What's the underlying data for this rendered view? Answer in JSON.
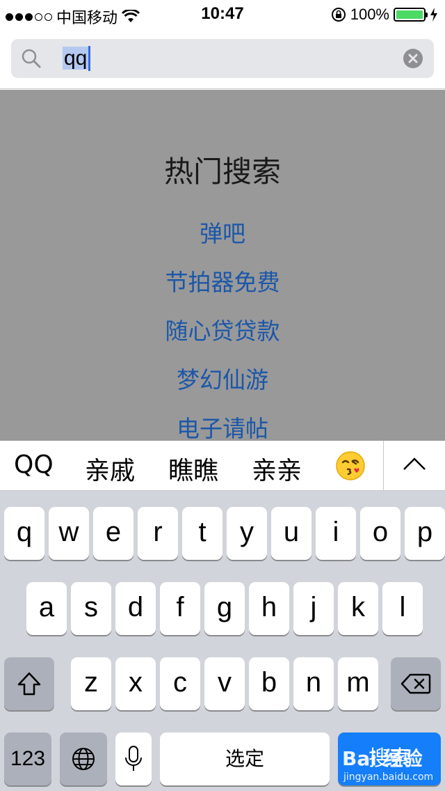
{
  "status_bar": {
    "carrier": "中国移动",
    "time": "10:47",
    "battery": "100%",
    "battery_level": 1.0
  },
  "search": {
    "query": "qq"
  },
  "hot_search": {
    "title": "热门搜索",
    "items": [
      "弹吧",
      "节拍器免费",
      "随心贷贷款",
      "梦幻仙游",
      "电子请帖"
    ]
  },
  "suggestions": {
    "items": [
      "QQ",
      "亲戚",
      "瞧瞧",
      "亲亲"
    ],
    "emoji": "kissing-face-emoji"
  },
  "keyboard": {
    "row1": [
      "q",
      "w",
      "e",
      "r",
      "t",
      "y",
      "u",
      "i",
      "o",
      "p"
    ],
    "row2": [
      "a",
      "s",
      "d",
      "f",
      "g",
      "h",
      "j",
      "k",
      "l"
    ],
    "row3": [
      "z",
      "x",
      "c",
      "v",
      "b",
      "n",
      "m"
    ],
    "numbers_label": "123",
    "space_label": "选定",
    "go_label": "搜索"
  },
  "watermark": {
    "main": "Bai 经验",
    "sub": "jingyan.baidu.com"
  },
  "colors": {
    "accent": "#147efb",
    "link": "#1b57a8",
    "overlay": "#999999",
    "keyboard_bg": "#d1d4da"
  }
}
